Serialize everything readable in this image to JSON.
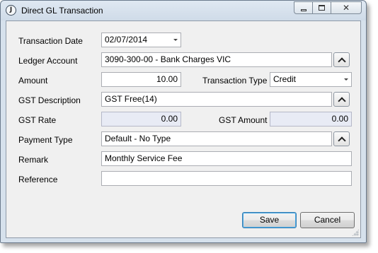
{
  "window": {
    "title": "Direct GL Transaction",
    "icon": "app-logo-icon",
    "icon_glyph": "J",
    "controls": {
      "minimize_icon": "minimize-icon",
      "maximize_icon": "maximize-icon",
      "close_glyph": "✕"
    }
  },
  "form": {
    "transaction_date": {
      "label": "Transaction Date",
      "value": "02/07/2014"
    },
    "ledger_account": {
      "label": "Ledger Account",
      "value": "3090-300-00 - Bank Charges VIC"
    },
    "amount": {
      "label": "Amount",
      "value": "10.00"
    },
    "transaction_type": {
      "label": "Transaction Type",
      "value": "Credit"
    },
    "gst_description": {
      "label": "GST Description",
      "value": "GST Free(14)"
    },
    "gst_rate": {
      "label": "GST Rate",
      "value": "0.00"
    },
    "gst_amount": {
      "label": "GST Amount",
      "value": "0.00"
    },
    "payment_type": {
      "label": "Payment Type",
      "value": "Default - No Type"
    },
    "remark": {
      "label": "Remark",
      "value": "Monthly Service Fee"
    },
    "reference": {
      "label": "Reference",
      "value": ""
    }
  },
  "buttons": {
    "save": "Save",
    "cancel": "Cancel"
  },
  "colors": {
    "readonly_field": "#e8ebf5",
    "default_button_border": "#3c7fb1"
  }
}
